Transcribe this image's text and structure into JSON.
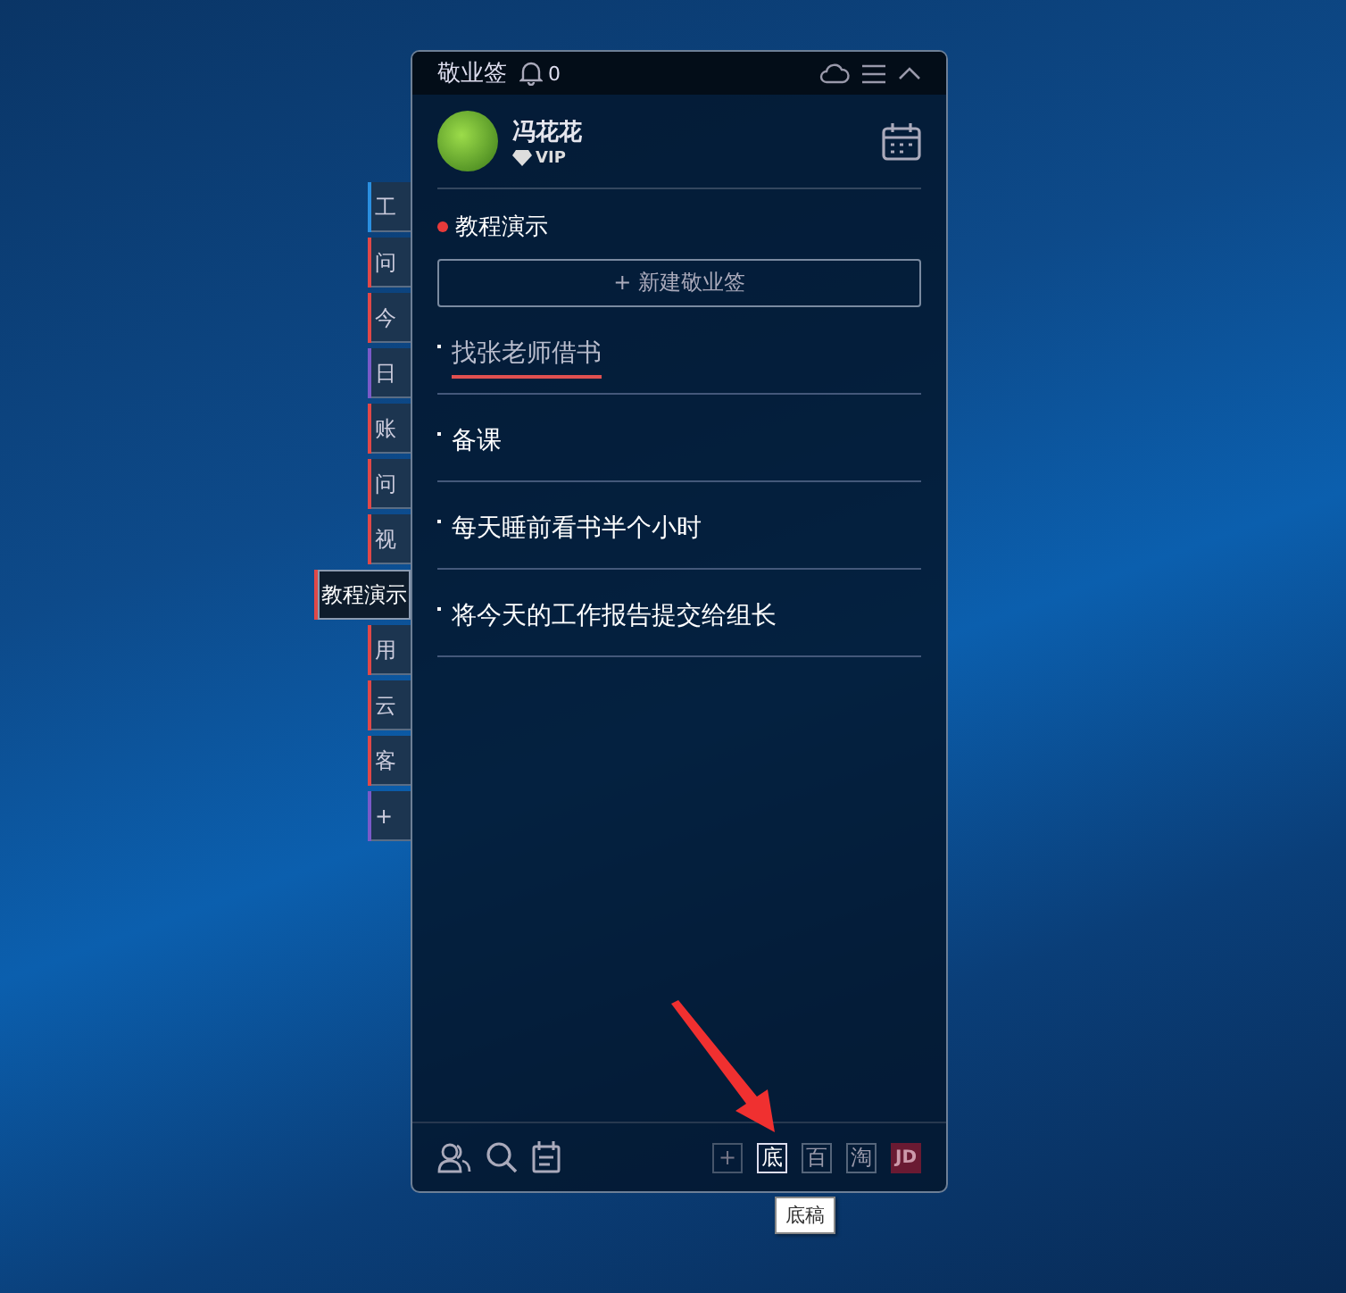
{
  "window": {
    "title": "敬业签",
    "notifications": "0"
  },
  "user": {
    "name": "冯花花",
    "badge": "VIP"
  },
  "category": {
    "title": "教程演示",
    "color": "#e83a3a"
  },
  "new_button": "+ 新建敬业签",
  "notes": [
    {
      "text": "找张老师借书",
      "done": true
    },
    {
      "text": "备课",
      "done": false
    },
    {
      "text": "每天睡前看书半个小时",
      "done": false
    },
    {
      "text": "将今天的工作报告提交给组长",
      "done": false
    }
  ],
  "side_tabs": [
    {
      "label": "工",
      "selected": false,
      "color": "#2a8fe0"
    },
    {
      "label": "问",
      "selected": false,
      "color": "#e04848"
    },
    {
      "label": "今",
      "selected": false,
      "color": "#e04848"
    },
    {
      "label": "日",
      "selected": false,
      "color": "#7a5ac8"
    },
    {
      "label": "账",
      "selected": false,
      "color": "#e04848"
    },
    {
      "label": "问",
      "selected": false,
      "color": "#e04848"
    },
    {
      "label": "视",
      "selected": false,
      "color": "#e04848"
    },
    {
      "label": "教程演示",
      "selected": true,
      "color": "#e04848"
    },
    {
      "label": "用",
      "selected": false,
      "color": "#e04848"
    },
    {
      "label": "云",
      "selected": false,
      "color": "#e04848"
    },
    {
      "label": "客",
      "selected": false,
      "color": "#e04848"
    },
    {
      "label": "+",
      "selected": false,
      "color": "#7a5ac8"
    }
  ],
  "shortcuts": [
    {
      "label": "+",
      "selected": false,
      "kind": "add"
    },
    {
      "label": "底",
      "selected": true,
      "kind": "text"
    },
    {
      "label": "百",
      "selected": false,
      "kind": "text"
    },
    {
      "label": "淘",
      "selected": false,
      "kind": "text"
    },
    {
      "label": "JD",
      "selected": false,
      "kind": "brand"
    }
  ],
  "tooltip": "底稿"
}
